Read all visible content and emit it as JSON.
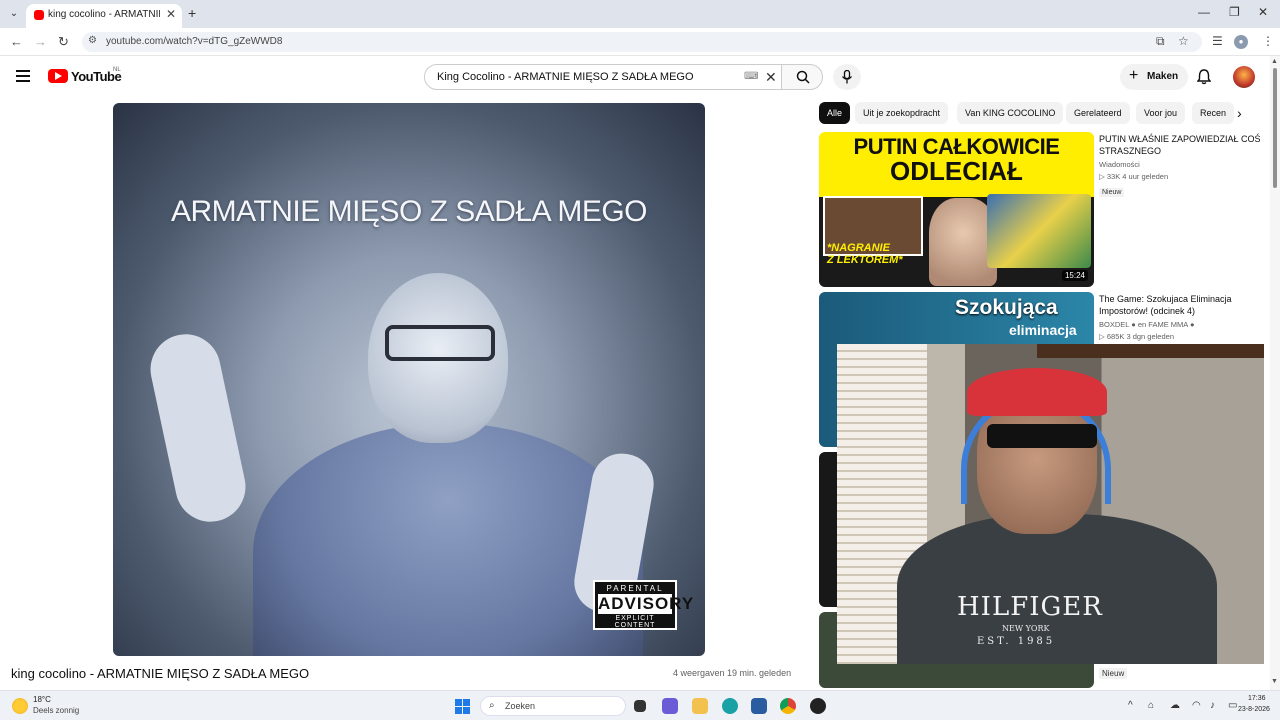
{
  "browser": {
    "tab_title": "king cocolino - ARMATNIE MIĘ",
    "url": "youtube.com/watch?v=dTG_gZeWWD8",
    "new_tab_glyph": "+",
    "tab_close_glyph": "✕"
  },
  "youtube": {
    "wordmark": "YouTube",
    "region": "NL",
    "search_query": "King Cocolino - ARMATNIE MIĘSO Z SADŁA MEGO",
    "create_label": "Maken",
    "accent_color": "#ff0000"
  },
  "video": {
    "overlay_text": "ARMATNIE MIĘSO Z SADŁA MEGO",
    "advisory": {
      "line1": "PARENTAL",
      "line2": "ADVISORY",
      "line3": "EXPLICIT CONTENT"
    },
    "title": "king cocolino - ARMATNIE MIĘSO Z SADŁA MEGO",
    "meta": "4 weergaven  19 min. geleden"
  },
  "chips": [
    {
      "label": "Alle",
      "active": true
    },
    {
      "label": "Uit je zoekopdracht"
    },
    {
      "label": "Van KING COCOLINO"
    },
    {
      "label": "Gerelateerd"
    },
    {
      "label": "Voor jou"
    },
    {
      "label": "Recen"
    }
  ],
  "recommendations": [
    {
      "thumb_line1": "PUTIN CAŁKOWICIE",
      "thumb_line2": "ODLECIAŁ",
      "thumb_caption1": "*NAGRANIE",
      "thumb_caption2": "Z LEKTOREM*",
      "duration": "15:24",
      "title": "PUTIN WŁAŚNIE ZAPOWIEDZIAŁ COŚ STRASZNEGO",
      "channel": "Wiadomości",
      "stats": "▷ 33K  4 uur geleden",
      "badge": "Nieuw"
    },
    {
      "thumb_line1": "Szokująca",
      "thumb_line2": "eliminacja",
      "title": "The Game: Szokujaca Eliminacja Impostorów! (odcinek 4)",
      "channel": "BOXDEL ● en FAME MMA ●",
      "stats": "▷ 685K  3 dgn geleden"
    }
  ],
  "bottom_badge": "Nieuw",
  "webcam": {
    "shirt_brand": "HILFIGER",
    "shirt_sub": "NEW YORK",
    "shirt_est": "EST. 1985"
  },
  "taskbar": {
    "weather_temp": "18°C",
    "weather_desc": "Deels zonnig",
    "search_label": "Zoeken",
    "time": "17:36",
    "date": "23-8-2026"
  }
}
